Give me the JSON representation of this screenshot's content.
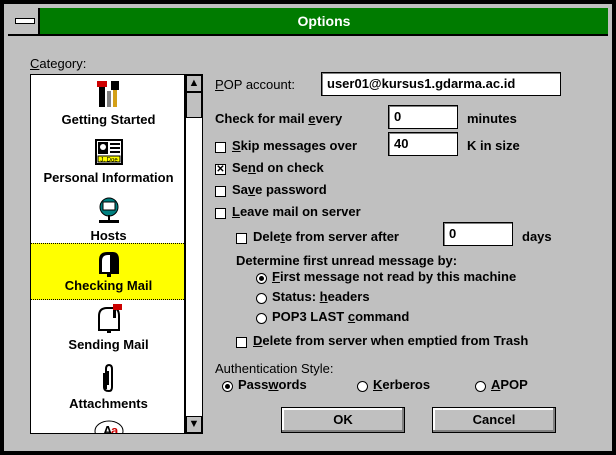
{
  "window": {
    "title": "Options"
  },
  "category": {
    "label": "Category:",
    "items": [
      {
        "label": "Getting Started",
        "icon": "tools-icon"
      },
      {
        "label": "Personal Information",
        "icon": "id-card-icon"
      },
      {
        "label": "Hosts",
        "icon": "network-computer-icon"
      },
      {
        "label": "Checking Mail",
        "icon": "mailbox-open-icon",
        "selected": true
      },
      {
        "label": "Sending Mail",
        "icon": "mailbox-flag-icon"
      },
      {
        "label": "Attachments",
        "icon": "paperclip-icon"
      }
    ]
  },
  "form": {
    "pop_account_label": "POP account:",
    "pop_account_value": "user01@kursus1.gdarma.ac.id",
    "check_every_label": "Check for mail every",
    "check_every_value": "0",
    "check_every_unit": "minutes",
    "skip_label": "Skip messages over",
    "skip_value": "40",
    "skip_unit": "K in size",
    "send_on_check_label": "Send on check",
    "save_password_label": "Save password",
    "leave_on_server_label": "Leave mail on server",
    "delete_after_label": "Delete from server after",
    "delete_after_value": "0",
    "delete_after_unit": "days",
    "determine_label": "Determine first unread message by:",
    "radio_first": "First message not read by this machine",
    "radio_status": "Status: headers",
    "radio_pop3": "POP3 LAST command",
    "delete_trash_label": "Delete from server when emptied from Trash",
    "auth_label": "Authentication Style:",
    "auth_passwords": "Passwords",
    "auth_kerberos": "Kerberos",
    "auth_apop": "APOP"
  },
  "buttons": {
    "ok": "OK",
    "cancel": "Cancel"
  },
  "state": {
    "skip_checked": false,
    "send_on_check": true,
    "save_password": false,
    "leave_on_server": false,
    "delete_after": false,
    "delete_trash": false,
    "unread_method": "first",
    "auth": "passwords"
  }
}
